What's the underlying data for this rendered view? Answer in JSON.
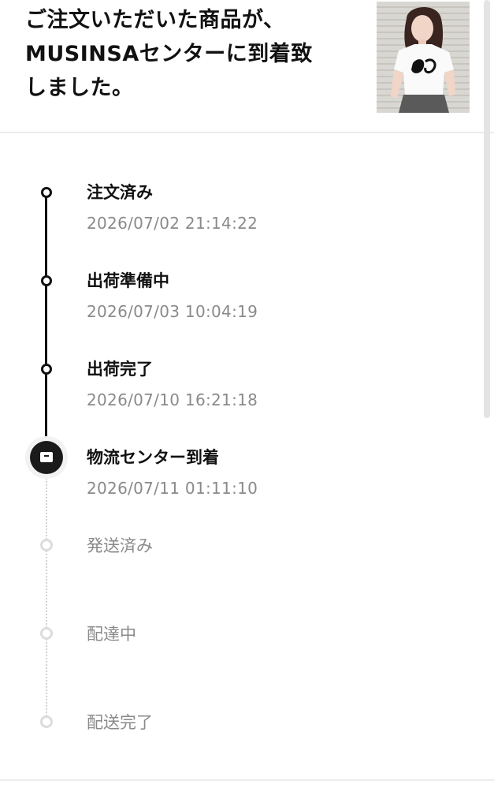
{
  "header": {
    "title": "ご注文いただいた商品が、\nMUSINSAセンターに到着致\nしました。",
    "thumbnail_icon": "product-photo"
  },
  "timeline": {
    "steps": [
      {
        "label": "注文済み",
        "timestamp": "2026/07/02 21:14:22",
        "status": "done"
      },
      {
        "label": "出荷準備中",
        "timestamp": "2026/07/03 10:04:19",
        "status": "done"
      },
      {
        "label": "出荷完了",
        "timestamp": "2026/07/10 16:21:18",
        "status": "done"
      },
      {
        "label": "物流センター到着",
        "timestamp": "2026/07/11 01:11:10",
        "status": "current"
      },
      {
        "label": "発送済み",
        "timestamp": "",
        "status": "pending"
      },
      {
        "label": "配達中",
        "timestamp": "",
        "status": "pending"
      },
      {
        "label": "配送完了",
        "timestamp": "",
        "status": "pending"
      }
    ]
  },
  "colors": {
    "active": "#111111",
    "pending": "#8a8a8a",
    "divider": "#ececec"
  }
}
